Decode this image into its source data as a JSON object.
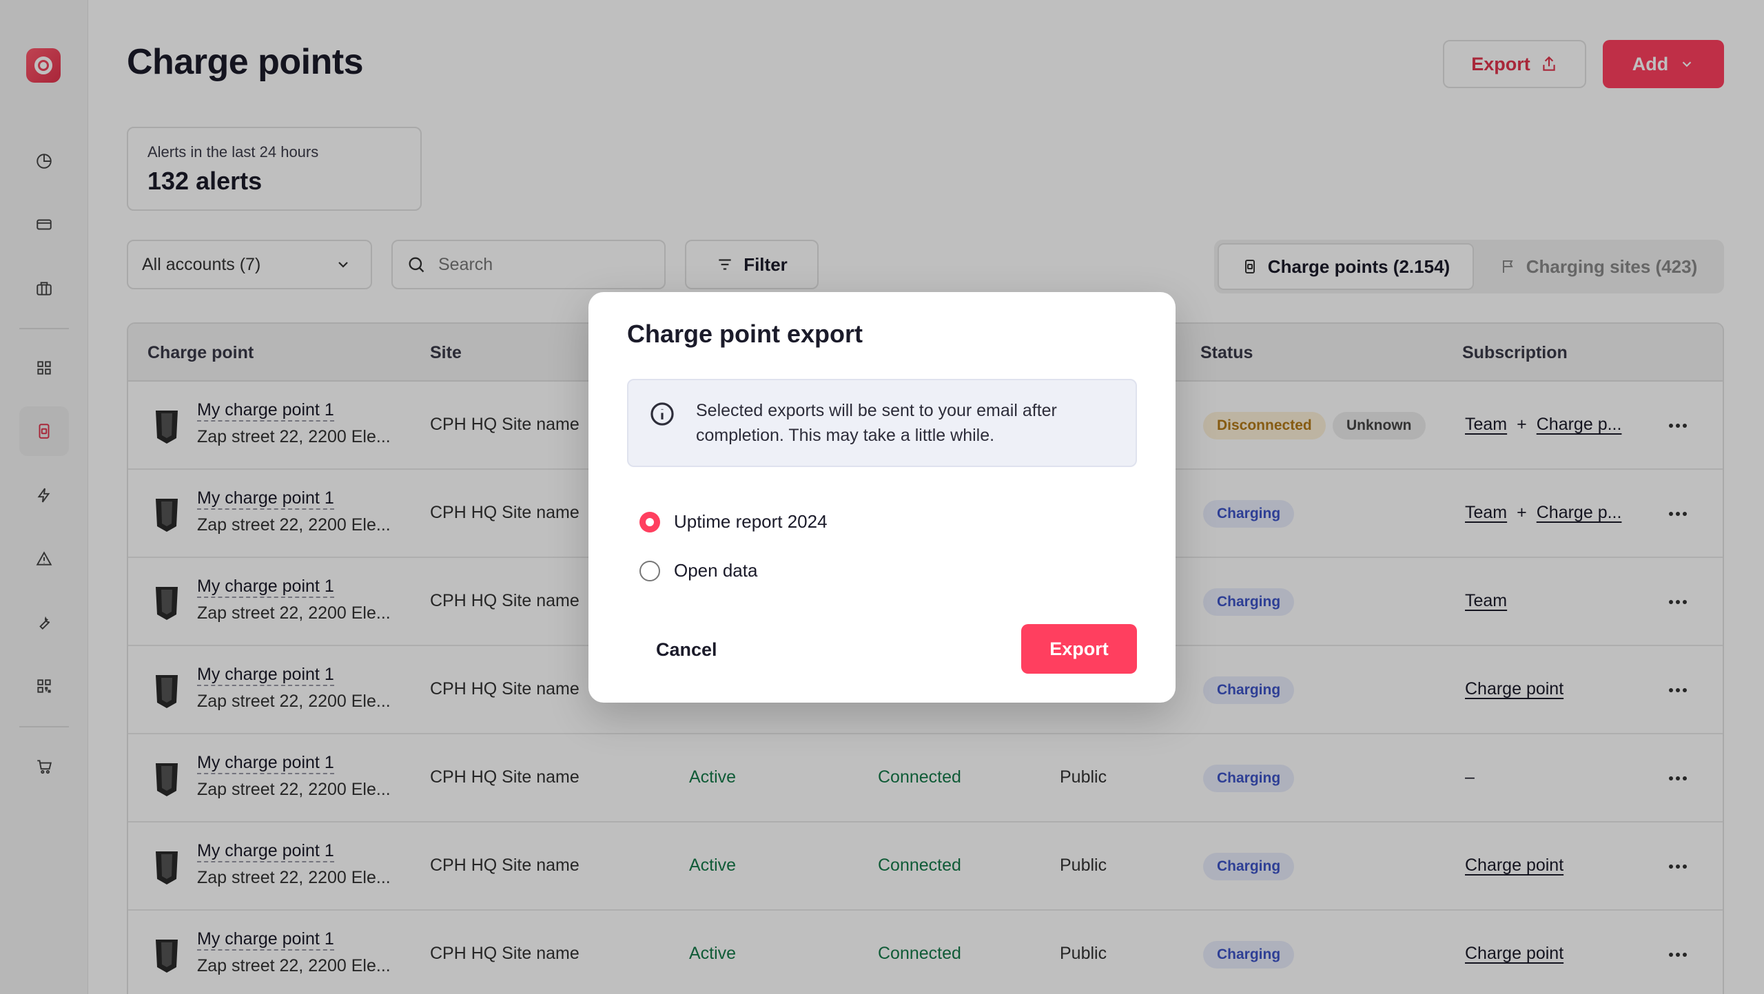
{
  "page": {
    "title": "Charge points"
  },
  "header": {
    "export_label": "Export",
    "add_label": "Add"
  },
  "alerts": {
    "label": "Alerts in the last 24 hours",
    "value": "132 alerts"
  },
  "toolbar": {
    "accounts_value": "All accounts (7)",
    "search_placeholder": "Search",
    "filter_label": "Filter"
  },
  "segments": [
    {
      "label": "Charge points (2.154)",
      "active": true
    },
    {
      "label": "Charging sites (423)",
      "active": false
    }
  ],
  "table": {
    "columns": {
      "charge_point": "Charge point",
      "site": "Site",
      "status": "Status",
      "subscription": "Subscription"
    },
    "rows": [
      {
        "name": "My charge point 1",
        "address": "Zap street 22, 2200 Ele...",
        "site": "CPH HQ Site name",
        "state": "",
        "connection": "",
        "access": "",
        "status": "Disconnected",
        "status2": "Unknown",
        "sub1": "Team",
        "plus": "+",
        "sub2": "Charge p..."
      },
      {
        "name": "My charge point 1",
        "address": "Zap street 22, 2200 Ele...",
        "site": "CPH HQ Site name",
        "state": "",
        "connection": "",
        "access": "",
        "status": "Charging",
        "status2": "",
        "sub1": "Team",
        "plus": "+",
        "sub2": "Charge p..."
      },
      {
        "name": "My charge point 1",
        "address": "Zap street 22, 2200 Ele...",
        "site": "CPH HQ Site name",
        "state": "",
        "connection": "",
        "access": "",
        "status": "Charging",
        "status2": "",
        "sub1": "Team",
        "plus": "",
        "sub2": ""
      },
      {
        "name": "My charge point 1",
        "address": "Zap street 22, 2200 Ele...",
        "site": "CPH HQ Site name",
        "state": "",
        "connection": "",
        "access": "",
        "status": "Charging",
        "status2": "",
        "sub1": "Charge point",
        "plus": "",
        "sub2": ""
      },
      {
        "name": "My charge point 1",
        "address": "Zap street 22, 2200 Ele...",
        "site": "CPH HQ Site name",
        "state": "Active",
        "connection": "Connected",
        "access": "Public",
        "status": "Charging",
        "status2": "",
        "sub1": "–",
        "plus": "",
        "sub2": ""
      },
      {
        "name": "My charge point 1",
        "address": "Zap street 22, 2200 Ele...",
        "site": "CPH HQ Site name",
        "state": "Active",
        "connection": "Connected",
        "access": "Public",
        "status": "Charging",
        "status2": "",
        "sub1": "Charge point",
        "plus": "",
        "sub2": ""
      },
      {
        "name": "My charge point 1",
        "address": "Zap street 22, 2200 Ele...",
        "site": "CPH HQ Site name",
        "state": "Active",
        "connection": "Connected",
        "access": "Public",
        "status": "Charging",
        "status2": "",
        "sub1": "Charge point",
        "plus": "",
        "sub2": ""
      }
    ]
  },
  "modal": {
    "title": "Charge point export",
    "info": "Selected exports will be sent to your email after completion. This may take a little while.",
    "options": [
      {
        "label": "Uptime report 2024",
        "checked": true
      },
      {
        "label": "Open data",
        "checked": false
      }
    ],
    "cancel_label": "Cancel",
    "export_label": "Export"
  },
  "colors": {
    "brand": "#ff3f5f",
    "charging": "#3e55c7",
    "connected": "#167a4a",
    "disconnected": "#b37a18"
  }
}
